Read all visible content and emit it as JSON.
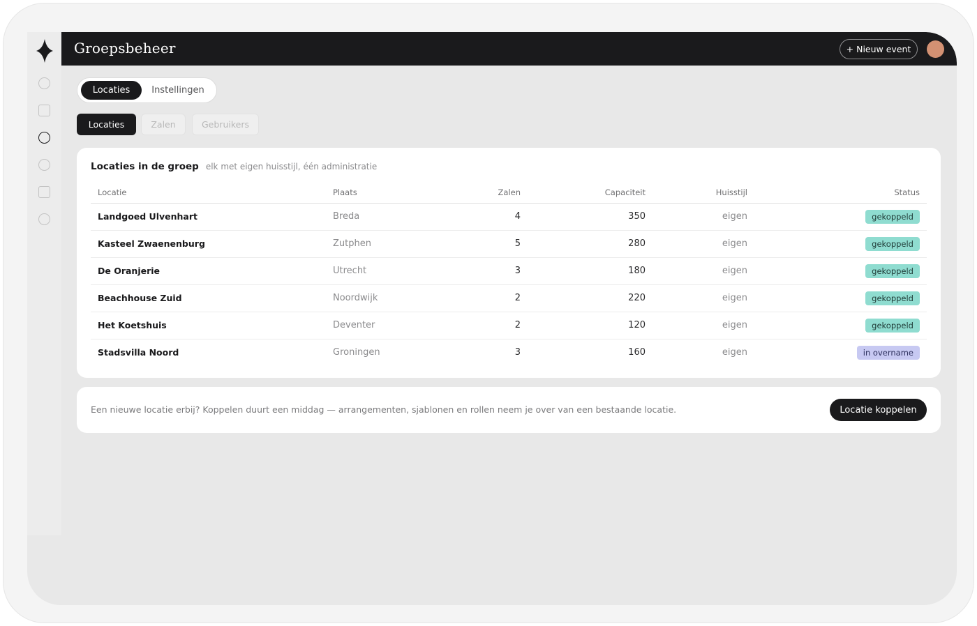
{
  "app": {
    "title": "Groepsbeheer"
  },
  "topbar": {
    "new_event_label": "+ Nieuw event"
  },
  "nav_icons": [
    "logo-icon",
    "circle-icon",
    "square-icon",
    "circle-icon",
    "circle-icon",
    "square-icon",
    "circle-icon"
  ],
  "segment": {
    "options": [
      {
        "label": "Locaties",
        "active": true
      },
      {
        "label": "Instellingen",
        "active": false
      }
    ]
  },
  "subtabs": [
    {
      "label": "Locaties",
      "active": true
    },
    {
      "label": "Zalen",
      "active": false
    },
    {
      "label": "Gebruikers",
      "active": false
    }
  ],
  "locations_card": {
    "title": "Locaties in de groep",
    "subtitle": "elk met eigen huisstijl, één administratie",
    "columns": [
      "Locatie",
      "Plaats",
      "Zalen",
      "Capaciteit",
      "Huisstijl",
      "Status"
    ],
    "rows": [
      {
        "name": "Landgoed Ulvenhart",
        "place": "Breda",
        "rooms": "4",
        "capacity": "350",
        "style": "eigen",
        "status": "gekoppeld"
      },
      {
        "name": "Kasteel Zwaenenburg",
        "place": "Zutphen",
        "rooms": "5",
        "capacity": "280",
        "style": "eigen",
        "status": "gekoppeld"
      },
      {
        "name": "De Oranjerie",
        "place": "Utrecht",
        "rooms": "3",
        "capacity": "180",
        "style": "eigen",
        "status": "gekoppeld"
      },
      {
        "name": "Beachhouse Zuid",
        "place": "Noordwijk",
        "rooms": "2",
        "capacity": "220",
        "style": "eigen",
        "status": "gekoppeld"
      },
      {
        "name": "Het Koetshuis",
        "place": "Deventer",
        "rooms": "2",
        "capacity": "120",
        "style": "eigen",
        "status": "gekoppeld"
      },
      {
        "name": "Stadsvilla Noord",
        "place": "Groningen",
        "rooms": "3",
        "capacity": "160",
        "style": "eigen",
        "status": "in overname"
      }
    ]
  },
  "link_card": {
    "message": "Een nieuwe locatie erbij? Koppelen duurt een middag — arrangementen, sjablonen en rollen neem je over van een bestaande locatie.",
    "button_label": "Locatie koppelen"
  },
  "colors": {
    "dark": "#1a1a1c",
    "status_linked": "#8fdcd0",
    "status_pending": "#c7c9f2",
    "avatar": "#d39173"
  }
}
